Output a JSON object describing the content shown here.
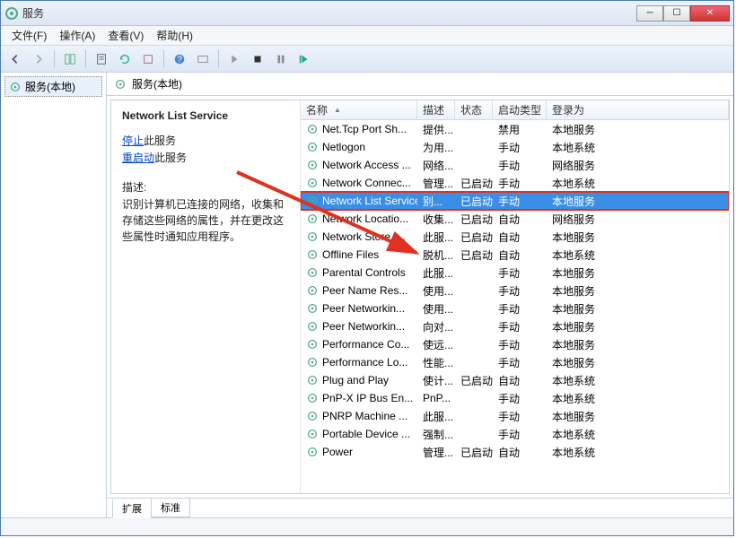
{
  "window": {
    "title": "服务"
  },
  "menu": {
    "file": "文件(F)",
    "action": "操作(A)",
    "view": "查看(V)",
    "help": "帮助(H)"
  },
  "tree": {
    "root": "服务(本地)"
  },
  "header": {
    "title": "服务(本地)"
  },
  "detail": {
    "title": "Network List Service",
    "stop": "停止",
    "stop_suffix": "此服务",
    "restart": "重启动",
    "restart_suffix": "此服务",
    "desc_label": "描述:",
    "desc": "识别计算机已连接的网络，收集和存储这些网络的属性，并在更改这些属性时通知应用程序。"
  },
  "columns": {
    "name": "名称",
    "desc": "描述",
    "status": "状态",
    "startup": "启动类型",
    "logon": "登录为"
  },
  "rows": [
    {
      "name": "Net.Tcp Port Sh...",
      "desc": "提供...",
      "status": "",
      "startup": "禁用",
      "logon": "本地服务"
    },
    {
      "name": "Netlogon",
      "desc": "为用...",
      "status": "",
      "startup": "手动",
      "logon": "本地系统"
    },
    {
      "name": "Network Access ...",
      "desc": "网络...",
      "status": "",
      "startup": "手动",
      "logon": "网络服务"
    },
    {
      "name": "Network Connec...",
      "desc": "管理...",
      "status": "已启动",
      "startup": "手动",
      "logon": "本地系统"
    },
    {
      "name": "Network List Service",
      "desc": "别...",
      "status": "已启动",
      "startup": "手动",
      "logon": "本地服务",
      "selected": true
    },
    {
      "name": "Network Locatio...",
      "desc": "收集...",
      "status": "已启动",
      "startup": "自动",
      "logon": "网络服务"
    },
    {
      "name": "Network Store I...",
      "desc": "此服...",
      "status": "已启动",
      "startup": "自动",
      "logon": "本地服务"
    },
    {
      "name": "Offline Files",
      "desc": "脱机...",
      "status": "已启动",
      "startup": "自动",
      "logon": "本地系统"
    },
    {
      "name": "Parental Controls",
      "desc": "此服...",
      "status": "",
      "startup": "手动",
      "logon": "本地服务"
    },
    {
      "name": "Peer Name Res...",
      "desc": "使用...",
      "status": "",
      "startup": "手动",
      "logon": "本地服务"
    },
    {
      "name": "Peer Networkin...",
      "desc": "使用...",
      "status": "",
      "startup": "手动",
      "logon": "本地服务"
    },
    {
      "name": "Peer Networkin...",
      "desc": "向对...",
      "status": "",
      "startup": "手动",
      "logon": "本地服务"
    },
    {
      "name": "Performance Co...",
      "desc": "使远...",
      "status": "",
      "startup": "手动",
      "logon": "本地服务"
    },
    {
      "name": "Performance Lo...",
      "desc": "性能...",
      "status": "",
      "startup": "手动",
      "logon": "本地服务"
    },
    {
      "name": "Plug and Play",
      "desc": "使计...",
      "status": "已启动",
      "startup": "自动",
      "logon": "本地系统"
    },
    {
      "name": "PnP-X IP Bus En...",
      "desc": "PnP...",
      "status": "",
      "startup": "手动",
      "logon": "本地系统"
    },
    {
      "name": "PNRP Machine ...",
      "desc": "此服...",
      "status": "",
      "startup": "手动",
      "logon": "本地服务"
    },
    {
      "name": "Portable Device ...",
      "desc": "强制...",
      "status": "",
      "startup": "手动",
      "logon": "本地系统"
    },
    {
      "name": "Power",
      "desc": "管理...",
      "status": "已启动",
      "startup": "自动",
      "logon": "本地系统"
    }
  ],
  "tabs": {
    "extended": "扩展",
    "standard": "标准"
  }
}
